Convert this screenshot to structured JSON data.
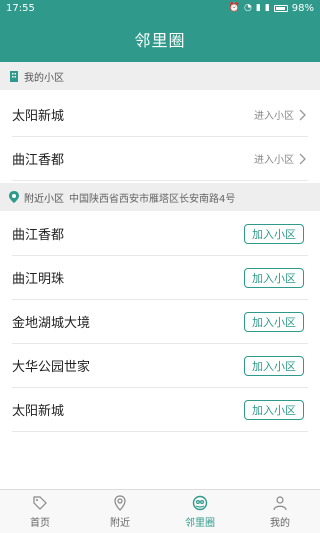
{
  "status": {
    "time": "17:55",
    "battery": "98%"
  },
  "header": {
    "title": "邻里圈"
  },
  "my_section": {
    "title": "我的小区",
    "items": [
      {
        "name": "太阳新城",
        "action": "进入小区"
      },
      {
        "name": "曲江香都",
        "action": "进入小区"
      }
    ]
  },
  "nearby_section": {
    "title": "附近小区",
    "address": "中国陕西省西安市雁塔区长安南路4号",
    "items": [
      {
        "name": "曲江香都",
        "action": "加入小区"
      },
      {
        "name": "曲江明珠",
        "action": "加入小区"
      },
      {
        "name": "金地湖城大境",
        "action": "加入小区"
      },
      {
        "name": "大华公园世家",
        "action": "加入小区"
      },
      {
        "name": "太阳新城",
        "action": "加入小区"
      }
    ]
  },
  "tabs": [
    {
      "label": "首页",
      "icon": "tag-icon"
    },
    {
      "label": "附近",
      "icon": "location-icon"
    },
    {
      "label": "邻里圈",
      "icon": "circle-icon"
    },
    {
      "label": "我的",
      "icon": "user-icon"
    }
  ],
  "colors": {
    "accent": "#2f9a8b"
  }
}
